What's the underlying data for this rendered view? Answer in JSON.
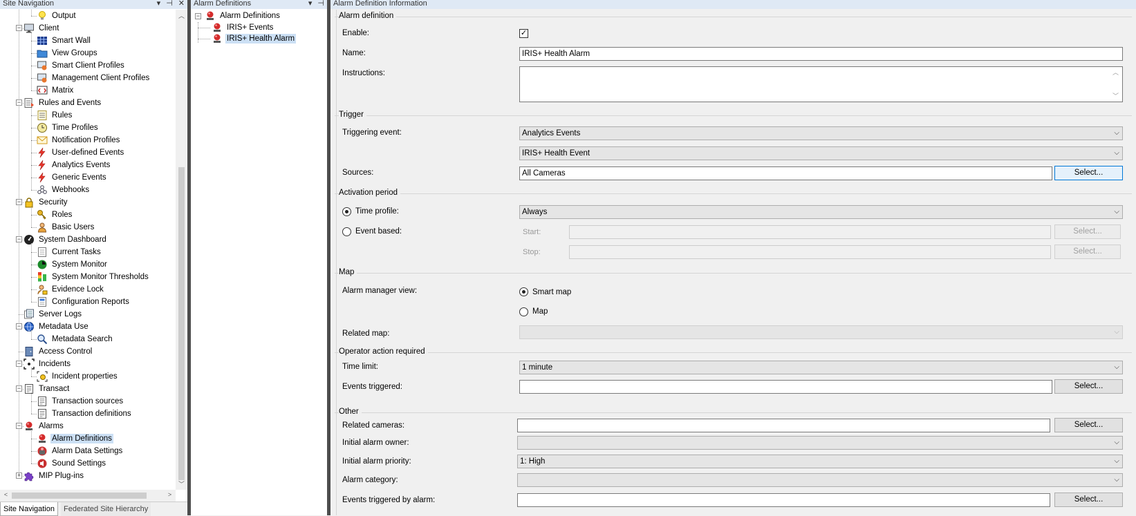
{
  "site_nav": {
    "title": "Site Navigation",
    "controls": [
      "▾",
      "⊣",
      "✕"
    ],
    "items": [
      {
        "label": "Output",
        "icon": "lightbulb-icon",
        "level": 2
      },
      {
        "label": "Client",
        "icon": "monitor-icon",
        "level": 1,
        "expanded": true
      },
      {
        "label": "Smart Wall",
        "icon": "grid-icon",
        "level": 2
      },
      {
        "label": "View Groups",
        "icon": "folder-icon",
        "level": 2
      },
      {
        "label": "Smart Client Profiles",
        "icon": "profile-icon",
        "level": 2
      },
      {
        "label": "Management Client Profiles",
        "icon": "profile-icon",
        "level": 2
      },
      {
        "label": "Matrix",
        "icon": "matrix-icon",
        "level": 2
      },
      {
        "label": "Rules and Events",
        "icon": "rules-icon",
        "level": 1,
        "expanded": true
      },
      {
        "label": "Rules",
        "icon": "list-icon",
        "level": 2
      },
      {
        "label": "Time Profiles",
        "icon": "clock-icon",
        "level": 2
      },
      {
        "label": "Notification Profiles",
        "icon": "envelope-icon",
        "level": 2
      },
      {
        "label": "User-defined Events",
        "icon": "bolt-icon",
        "level": 2
      },
      {
        "label": "Analytics Events",
        "icon": "bolt-icon",
        "level": 2
      },
      {
        "label": "Generic Events",
        "icon": "bolt-icon",
        "level": 2
      },
      {
        "label": "Webhooks",
        "icon": "webhook-icon",
        "level": 2
      },
      {
        "label": "Security",
        "icon": "lock-icon",
        "level": 1,
        "expanded": true
      },
      {
        "label": "Roles",
        "icon": "key-icon",
        "level": 2
      },
      {
        "label": "Basic Users",
        "icon": "user-icon",
        "level": 2
      },
      {
        "label": "System Dashboard",
        "icon": "dashboard-icon",
        "level": 1,
        "expanded": true
      },
      {
        "label": "Current Tasks",
        "icon": "tasks-icon",
        "level": 2
      },
      {
        "label": "System Monitor",
        "icon": "monitor-globe-icon",
        "level": 2
      },
      {
        "label": "System Monitor Thresholds",
        "icon": "thresholds-icon",
        "level": 2
      },
      {
        "label": "Evidence Lock",
        "icon": "evidence-lock-icon",
        "level": 2
      },
      {
        "label": "Configuration Reports",
        "icon": "report-icon",
        "level": 2
      },
      {
        "label": "Server Logs",
        "icon": "logs-icon",
        "level": 1
      },
      {
        "label": "Metadata Use",
        "icon": "metadata-icon",
        "level": 1,
        "expanded": true
      },
      {
        "label": "Metadata Search",
        "icon": "search-icon",
        "level": 2
      },
      {
        "label": "Access Control",
        "icon": "door-icon",
        "level": 1
      },
      {
        "label": "Incidents",
        "icon": "incidents-icon",
        "level": 1,
        "expanded": true
      },
      {
        "label": "Incident properties",
        "icon": "incident-props-icon",
        "level": 2
      },
      {
        "label": "Transact",
        "icon": "receipt-icon",
        "level": 1,
        "expanded": true
      },
      {
        "label": "Transaction sources",
        "icon": "receipt-icon",
        "level": 2
      },
      {
        "label": "Transaction definitions",
        "icon": "receipt-icon",
        "level": 2
      },
      {
        "label": "Alarms",
        "icon": "alarm-icon",
        "level": 1,
        "expanded": true
      },
      {
        "label": "Alarm Definitions",
        "icon": "alarm-icon",
        "level": 2,
        "selected": true
      },
      {
        "label": "Alarm Data Settings",
        "icon": "alarm-data-icon",
        "level": 2
      },
      {
        "label": "Sound Settings",
        "icon": "sound-icon",
        "level": 2
      },
      {
        "label": "MIP Plug-ins",
        "icon": "puzzle-icon",
        "level": 1,
        "collapsed": true
      }
    ],
    "tabs": [
      "Site Navigation",
      "Federated Site Hierarchy"
    ]
  },
  "alarm_defs": {
    "title": "Alarm Definitions",
    "controls": [
      "▾",
      "⊣"
    ],
    "root": "Alarm Definitions",
    "items": [
      "IRIS+ Events",
      "IRIS+ Health Alarm"
    ],
    "selected_index": 1
  },
  "detail": {
    "title": "Alarm Definition Information",
    "sections": {
      "alarm_definition": "Alarm definition",
      "trigger": "Trigger",
      "activation": "Activation period",
      "map": "Map",
      "operator": "Operator action required",
      "other": "Other"
    },
    "labels": {
      "enable": "Enable:",
      "name": "Name:",
      "instructions": "Instructions:",
      "triggering_event": "Triggering event:",
      "sources": "Sources:",
      "time_profile": "Time profile:",
      "event_based": "Event based:",
      "start": "Start:",
      "stop": "Stop:",
      "alarm_manager_view": "Alarm manager view:",
      "smart_map": "Smart map",
      "map": "Map",
      "related_map": "Related map:",
      "time_limit": "Time limit:",
      "events_triggered": "Events triggered:",
      "related_cameras": "Related cameras:",
      "initial_alarm_owner": "Initial alarm owner:",
      "initial_alarm_priority": "Initial alarm priority:",
      "alarm_category": "Alarm category:",
      "events_triggered_by_alarm": "Events triggered by alarm:"
    },
    "values": {
      "enabled": true,
      "name": "IRIS+ Health Alarm",
      "instructions": "",
      "triggering_event": "Analytics Events",
      "triggering_subevent": "IRIS+ Health Event",
      "sources": "All Cameras",
      "time_profile": "Always",
      "time_limit": "1 minute",
      "initial_alarm_priority": "1: High"
    },
    "select_label": "Select..."
  }
}
